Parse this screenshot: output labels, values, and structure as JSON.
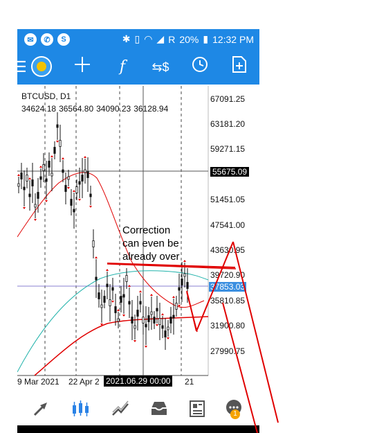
{
  "status_bar": {
    "left_icons": [
      "message-icon",
      "whatsapp-icon",
      "sf-icon"
    ],
    "battery": "20%",
    "carrier_letter": "R",
    "time": "12:32 PM"
  },
  "toolbar": {
    "icons": [
      "menu-icon",
      "metatrader-logo-icon",
      "crosshair-icon",
      "indicators-icon",
      "objects-icon",
      "timeframe-icon",
      "new-order-icon"
    ]
  },
  "chart": {
    "symbol": "BTCUSD, D1",
    "ohlc": [
      "34624.18",
      "36564.80",
      "34090.23",
      "36128.94"
    ],
    "price_axis": [
      "67091.25",
      "63181.20",
      "59271.15",
      "51451.05",
      "47541.00",
      "43630.95",
      "39720.90",
      "35810.85",
      "31900.80",
      "27990.75"
    ],
    "crosshair_price": "55675.09",
    "current_price": "37853.03",
    "dates": [
      "9 Mar 2021",
      "22 Apr 2",
      "21"
    ],
    "crosshair_date": "2021.06.29 00:00",
    "annotation": [
      "Correction",
      "can even be",
      "already over"
    ],
    "colors": {
      "bullish_arrow": "#e00000",
      "ma_red": "#e00000",
      "ma_teal": "#20b2aa",
      "current_line": "#8a7fd0",
      "current_label_bg": "#3b8fe0"
    }
  },
  "bottom_bar": {
    "icons": [
      "trade-icon",
      "chart-icon",
      "history-icon",
      "inbox-icon",
      "news-icon",
      "chat-icon"
    ],
    "chat_badge": "1"
  }
}
